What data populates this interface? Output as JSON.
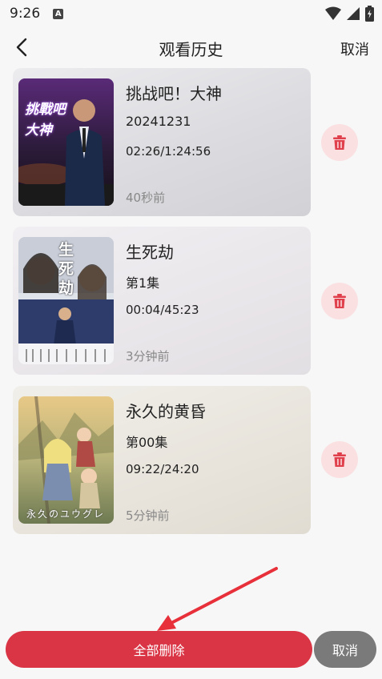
{
  "status_bar": {
    "time": "9:26",
    "notification_letter": "A"
  },
  "header": {
    "title": "观看历史",
    "cancel_label": "取消"
  },
  "history": [
    {
      "title": "挑战吧！大神",
      "episode": "20241231",
      "progress": "02:26/1:24:56",
      "time_ago": "40秒前",
      "thumb_text": "挑戰吧 大神"
    },
    {
      "title": "生死劫",
      "episode": "第1集",
      "progress": "00:04/45:23",
      "time_ago": "3分钟前",
      "thumb_text": "生死劫"
    },
    {
      "title": "永久的黄昏",
      "episode": "第00集",
      "progress": "09:22/24:20",
      "time_ago": "5分钟前",
      "thumb_text": "永久のユウグレ"
    }
  ],
  "footer": {
    "delete_all_label": "全部删除",
    "cancel_label": "取消"
  },
  "colors": {
    "accent": "#d93545",
    "delete_bg": "#fbe0e2",
    "cancel_bg": "#7a7a7a",
    "annotation": "#e8303a"
  }
}
